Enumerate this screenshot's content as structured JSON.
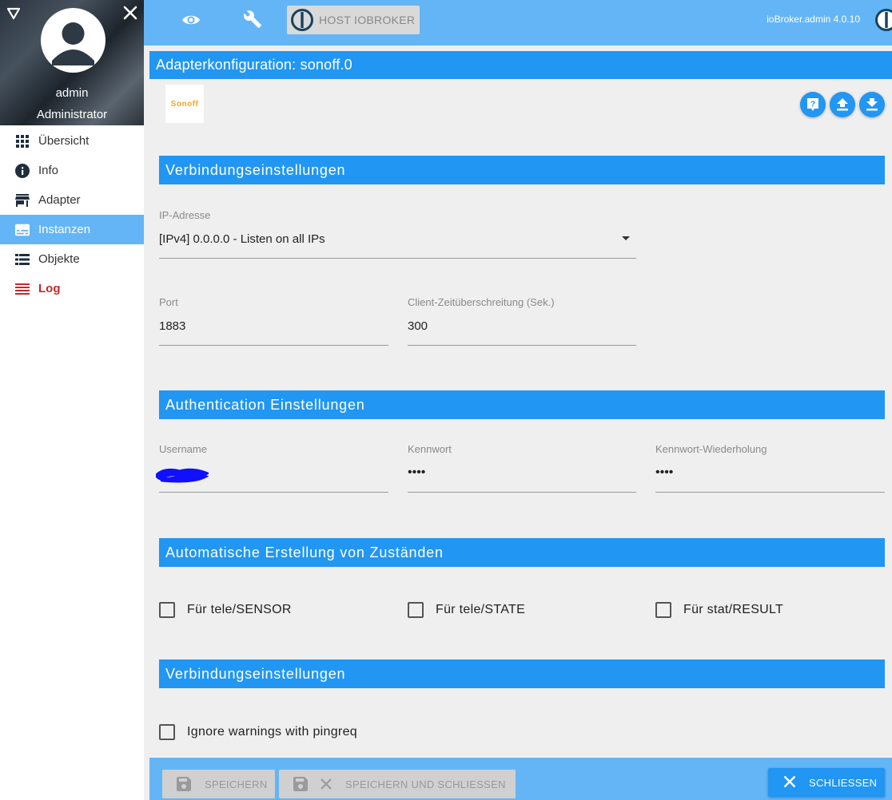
{
  "sidebar": {
    "user_name": "admin",
    "user_role": "Administrator",
    "items": [
      {
        "label": "Übersicht",
        "icon": "apps-grid-icon"
      },
      {
        "label": "Info",
        "icon": "info-icon"
      },
      {
        "label": "Adapter",
        "icon": "store-icon"
      },
      {
        "label": "Instanzen",
        "icon": "subtitles-icon",
        "active": true
      },
      {
        "label": "Objekte",
        "icon": "list-icon"
      },
      {
        "label": "Log",
        "icon": "log-lines-icon"
      }
    ]
  },
  "topbar": {
    "host_button_label": "HOST IOBROKER",
    "version": "ioBroker.admin 4.0.10"
  },
  "config": {
    "title": "Adapterkonfiguration: sonoff.0",
    "logo_text": "Sonoff"
  },
  "sections": {
    "connection": "Verbindungseinstellungen",
    "auth": "Authentication Einstellungen",
    "auto_states": "Automatische Erstellung von Zuständen",
    "connection2": "Verbindungseinstellungen"
  },
  "fields": {
    "ip_label": "IP-Adresse",
    "ip_value": "[IPv4] 0.0.0.0 - Listen on all IPs",
    "port_label": "Port",
    "port_value": "1883",
    "timeout_label": "Client-Zeitüberschreitung (Sek.)",
    "timeout_value": "300",
    "username_label": "Username",
    "password_label": "Kennwort",
    "password_value": "••••",
    "password_repeat_label": "Kennwort-Wiederholung",
    "password_repeat_value": "••••"
  },
  "checkboxes": {
    "tele_sensor": "Für tele/SENSOR",
    "tele_state": "Für tele/STATE",
    "stat_result": "Für stat/RESULT",
    "ignore_pingreq": "Ignore warnings with pingreq"
  },
  "footer": {
    "save_label": "SPEICHERN",
    "save_close_label": "SPEICHERN UND SCHLIESSEN",
    "close_label": "SCHLIESSEN"
  },
  "colors": {
    "primary": "#2196f3",
    "light_primary": "#64b5f6",
    "log_red": "#c62828"
  }
}
